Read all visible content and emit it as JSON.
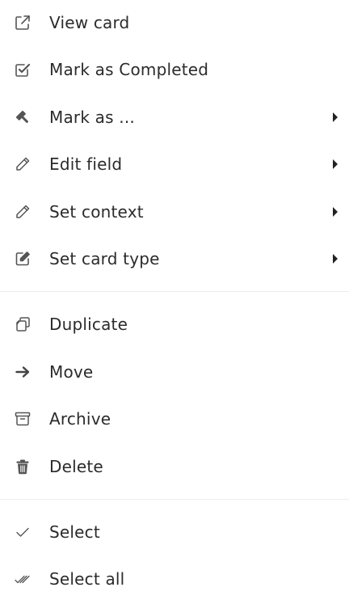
{
  "menu": {
    "section1": [
      {
        "label": "View card",
        "icon": "external-link-icon",
        "submenu": false
      },
      {
        "label": "Mark as Completed",
        "icon": "checkbox-checked-icon",
        "submenu": false
      },
      {
        "label": "Mark as ...",
        "icon": "gavel-icon",
        "submenu": true
      },
      {
        "label": "Edit field",
        "icon": "pencil-icon",
        "submenu": true
      },
      {
        "label": "Set context",
        "icon": "pencil-icon",
        "submenu": true
      },
      {
        "label": "Set card type",
        "icon": "edit-square-icon",
        "submenu": true
      }
    ],
    "section2": [
      {
        "label": "Duplicate",
        "icon": "duplicate-icon",
        "submenu": false
      },
      {
        "label": "Move",
        "icon": "arrow-right-icon",
        "submenu": false
      },
      {
        "label": "Archive",
        "icon": "archive-box-icon",
        "submenu": false
      },
      {
        "label": "Delete",
        "icon": "trash-icon",
        "submenu": false
      }
    ],
    "section3": [
      {
        "label": "Select",
        "icon": "check-icon",
        "submenu": false
      },
      {
        "label": "Select all",
        "icon": "double-check-icon",
        "submenu": false
      }
    ]
  },
  "colors": {
    "text": "#2b2b2b",
    "icon": "#555555",
    "divider": "#ececec",
    "background": "#ffffff"
  }
}
